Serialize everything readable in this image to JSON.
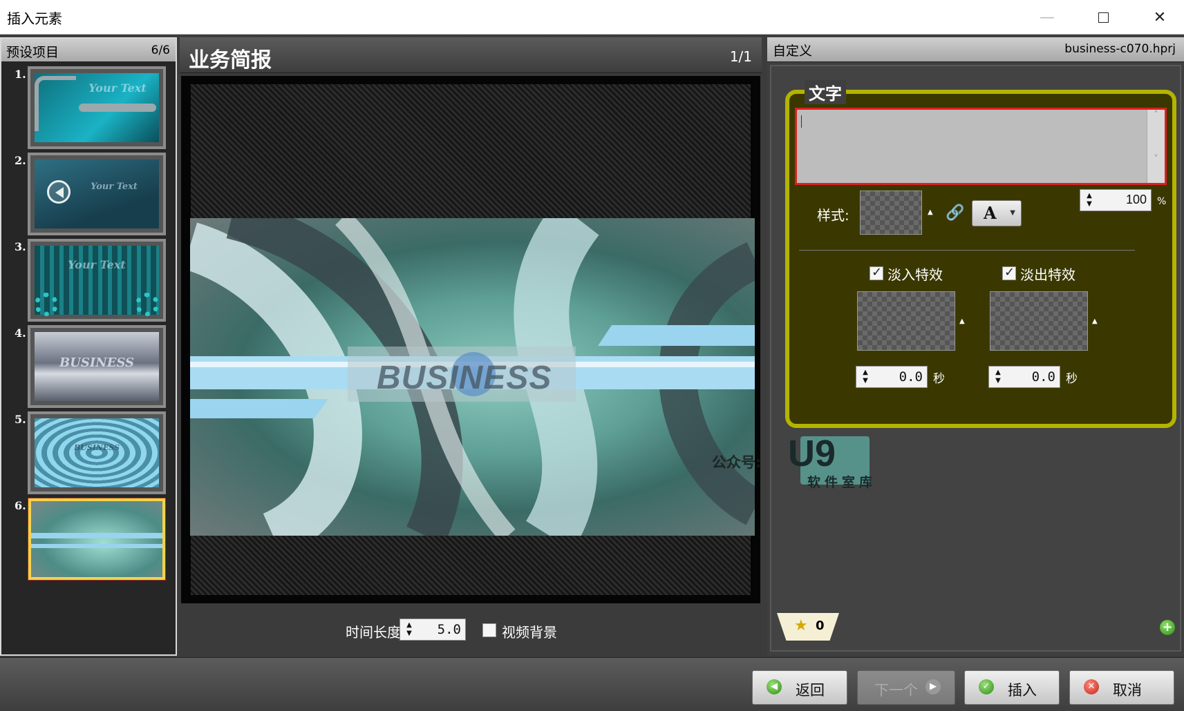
{
  "window": {
    "title": "插入元素",
    "controls": {
      "minimize": "—",
      "close": "✕"
    }
  },
  "presets_panel": {
    "title": "预设项目",
    "count": "6/6",
    "items": [
      {
        "number": "1.",
        "thumb_text": "Your Text",
        "theme": "teal pipes"
      },
      {
        "number": "2.",
        "thumb_text": "Your Text",
        "theme": "teal play"
      },
      {
        "number": "3.",
        "thumb_text": "Your Text",
        "theme": "teal gears"
      },
      {
        "number": "4.",
        "thumb_text": "BUSINESS",
        "theme": "grey business"
      },
      {
        "number": "5.",
        "thumb_text": "BUSINESS",
        "theme": "blue rings"
      },
      {
        "number": "6.",
        "thumb_text": "",
        "theme": "selected business",
        "selected": true
      }
    ]
  },
  "preview_panel": {
    "title": "业务简报",
    "page": "1/1",
    "brand_text": "BUSINESS",
    "duration_label": "时间长度:",
    "duration_value": "5.0",
    "video_bg_label": "视频背景",
    "video_bg_checked": false
  },
  "custom_panel": {
    "title": "自定义",
    "filename": "business-c070.hprj",
    "text_group_label": "文字",
    "text_value": "",
    "opacity_value": "100",
    "opacity_unit": "%",
    "style_label": "样式:",
    "font_button_label": "A",
    "fade_in_label": "淡入特效",
    "fade_in_checked": true,
    "fade_out_label": "淡出特效",
    "fade_out_checked": true,
    "fade_in_seconds": "0.0",
    "fade_out_seconds": "0.0",
    "seconds_unit": "秒",
    "rating_count": "0",
    "icons": {
      "link": "link-icon",
      "add": "add-icon",
      "star": "star-icon"
    }
  },
  "watermark": {
    "prefix": "公众号:",
    "logo": "U9",
    "subtitle": "软件室库"
  },
  "footer": {
    "back_label": "返回",
    "next_label": "下一个",
    "insert_label": "插入",
    "cancel_label": "取消"
  },
  "colors": {
    "text_group_border": "#b4b400",
    "text_area_border": "#dd2020",
    "selected_thumb_border": "#f3d34a"
  }
}
